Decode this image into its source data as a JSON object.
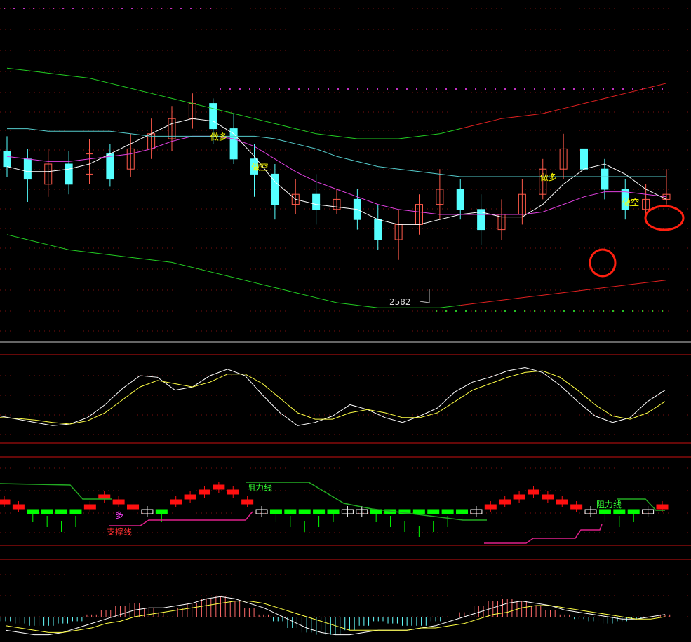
{
  "colors": {
    "background": "#000000",
    "bull_candle": "#ff5a4a",
    "bear_candle": "#55ffff",
    "band_green": "#22cc22",
    "band_red": "#e02020",
    "ma_white": "#ffffff",
    "ma_magenta": "#e040e0",
    "ma_cyan": "#55cccc",
    "stop_red": "#ff2020",
    "kdj_k": "#ffffff",
    "kdj_d": "#ffff44",
    "bar_red": "#ff1010",
    "bar_green": "#00ff00",
    "resist_green": "#22aa22",
    "support_magenta": "#e0208c",
    "label_yellow": "#ffff00",
    "label_red": "#ff3030",
    "label_magenta": "#ff40ff",
    "label_green": "#33ff33",
    "low_label": "#dddddd",
    "divider_red": "#cc1111"
  },
  "chart_data": [
    {
      "type": "candlestick",
      "panel": "price",
      "low_marker": "2582",
      "signals": [
        {
          "index": 10,
          "text": "做多"
        },
        {
          "index": 12,
          "text": "做空"
        },
        {
          "index": 26,
          "text": "做多"
        },
        {
          "index": 30,
          "text": "做空"
        }
      ],
      "candles": [
        {
          "o": 15,
          "c": 9,
          "h": 21,
          "l": 5
        },
        {
          "o": 12,
          "c": 4,
          "h": 16,
          "l": -5
        },
        {
          "o": 2,
          "c": 10,
          "h": 16,
          "l": -3
        },
        {
          "o": 10,
          "c": 2,
          "h": 15,
          "l": -2
        },
        {
          "o": 6,
          "c": 14,
          "h": 20,
          "l": 2
        },
        {
          "o": 14,
          "c": 4,
          "h": 18,
          "l": 1
        },
        {
          "o": 8,
          "c": 16,
          "h": 22,
          "l": 5
        },
        {
          "o": 16,
          "c": 22,
          "h": 28,
          "l": 12
        },
        {
          "o": 20,
          "c": 28,
          "h": 33,
          "l": 15
        },
        {
          "o": 28,
          "c": 34,
          "h": 38,
          "l": 24
        },
        {
          "o": 34,
          "c": 24,
          "h": 36,
          "l": 18
        },
        {
          "o": 24,
          "c": 12,
          "h": 30,
          "l": 10
        },
        {
          "o": 12,
          "c": 6,
          "h": 18,
          "l": -3
        },
        {
          "o": 6,
          "c": -6,
          "h": 10,
          "l": -12
        },
        {
          "o": -6,
          "c": -2,
          "h": 4,
          "l": -10
        },
        {
          "o": -2,
          "c": -8,
          "h": 6,
          "l": -14
        },
        {
          "o": -8,
          "c": -4,
          "h": 0,
          "l": -10
        },
        {
          "o": -4,
          "c": -12,
          "h": 0,
          "l": -16
        },
        {
          "o": -12,
          "c": -20,
          "h": -6,
          "l": -24
        },
        {
          "o": -20,
          "c": -14,
          "h": -8,
          "l": -28
        },
        {
          "o": -14,
          "c": -6,
          "h": -2,
          "l": -18
        },
        {
          "o": -6,
          "c": 0,
          "h": 8,
          "l": -12
        },
        {
          "o": 0,
          "c": -8,
          "h": 4,
          "l": -12
        },
        {
          "o": -8,
          "c": -16,
          "h": -2,
          "l": -22
        },
        {
          "o": -16,
          "c": -10,
          "h": -4,
          "l": -20
        },
        {
          "o": -10,
          "c": -2,
          "h": 4,
          "l": -14
        },
        {
          "o": -2,
          "c": 8,
          "h": 12,
          "l": -4
        },
        {
          "o": 8,
          "c": 16,
          "h": 22,
          "l": 4
        },
        {
          "o": 16,
          "c": 8,
          "h": 22,
          "l": 4
        },
        {
          "o": 8,
          "c": 0,
          "h": 12,
          "l": -4
        },
        {
          "o": 0,
          "c": -8,
          "h": 4,
          "l": -12
        },
        {
          "o": -8,
          "c": -4,
          "h": 2,
          "l": -10
        },
        {
          "o": -4,
          "c": -2,
          "h": 8,
          "l": -6
        }
      ],
      "series": [
        {
          "name": "MA5",
          "values": [
            9,
            7,
            7,
            8,
            10,
            14,
            18,
            22,
            26,
            28,
            27,
            22,
            13,
            3,
            -4,
            -6,
            -7,
            -8,
            -12,
            -14,
            -14,
            -12,
            -10,
            -9,
            -11,
            -11,
            -6,
            2,
            8,
            10,
            6,
            0,
            -4
          ]
        },
        {
          "name": "MA10",
          "values": [
            13,
            12,
            11,
            11,
            12,
            13,
            14,
            16,
            19,
            21,
            21,
            20,
            17,
            12,
            7,
            3,
            0,
            -3,
            -6,
            -8,
            -9,
            -10,
            -10,
            -10,
            -10,
            -10,
            -9,
            -6,
            -3,
            -1,
            -1,
            -2,
            -3
          ]
        },
        {
          "name": "MA20",
          "values": [
            24,
            24,
            23,
            23,
            23,
            23,
            22,
            21,
            21,
            21,
            21,
            21,
            21,
            20,
            18,
            16,
            13,
            11,
            9,
            8,
            7,
            6,
            5,
            5,
            5,
            5,
            5,
            5,
            5,
            5,
            5,
            5,
            5
          ]
        },
        {
          "name": "UPPER",
          "values": [
            48,
            47,
            46,
            45,
            44,
            42,
            40,
            38,
            36,
            34,
            32,
            30,
            28,
            26,
            24,
            22,
            21,
            20,
            20,
            20,
            21,
            22,
            24,
            26,
            28,
            29,
            30,
            32,
            34,
            36,
            38,
            40,
            42
          ]
        },
        {
          "name": "LOWER",
          "values": [
            -18,
            -20,
            -22,
            -24,
            -25,
            -26,
            -27,
            -28,
            -29,
            -31,
            -33,
            -35,
            -37,
            -39,
            -41,
            -43,
            -45,
            -46,
            -47,
            -47,
            -47,
            -47,
            -46,
            -45,
            -44,
            -43,
            -42,
            -41,
            -40,
            -39,
            -38,
            -37,
            -36
          ]
        }
      ]
    },
    {
      "type": "line",
      "panel": "kdj",
      "series": [
        {
          "name": "K",
          "values": [
            30,
            26,
            22,
            18,
            20,
            28,
            44,
            64,
            80,
            78,
            62,
            66,
            80,
            88,
            80,
            56,
            34,
            18,
            22,
            30,
            44,
            38,
            28,
            22,
            30,
            40,
            60,
            72,
            78,
            86,
            90,
            84,
            68,
            48,
            30,
            22,
            28,
            48,
            62
          ]
        },
        {
          "name": "D",
          "values": [
            28,
            27,
            25,
            22,
            20,
            24,
            34,
            50,
            66,
            74,
            70,
            66,
            72,
            82,
            82,
            70,
            52,
            34,
            26,
            26,
            34,
            38,
            34,
            28,
            28,
            34,
            48,
            62,
            70,
            78,
            84,
            86,
            78,
            62,
            44,
            30,
            26,
            34,
            48
          ]
        }
      ]
    },
    {
      "type": "bar",
      "panel": "trend",
      "labels": {
        "multi": "多",
        "support": "支撑线",
        "resist_a": "阻力线",
        "resist_b": "阻力线"
      },
      "values": [
        2,
        1,
        -1,
        -2,
        -3,
        -2,
        1,
        3,
        2,
        1,
        0,
        -1,
        2,
        3,
        4,
        5,
        4,
        2,
        0,
        -1,
        -2,
        -3,
        -2,
        -1,
        0,
        0,
        -1,
        -2,
        -3,
        -4,
        -3,
        -2,
        -1,
        0,
        1,
        2,
        3,
        4,
        3,
        2,
        1,
        0,
        -1,
        -2,
        -1,
        0,
        1
      ]
    },
    {
      "type": "bar",
      "panel": "macd",
      "values": [
        -2,
        -3,
        -4,
        -4,
        -3,
        -2,
        1,
        3,
        5,
        6,
        4,
        2,
        4,
        6,
        8,
        9,
        7,
        4,
        1,
        -2,
        -5,
        -7,
        -8,
        -8,
        -6,
        -4,
        -2,
        -3,
        -4,
        -4,
        -2,
        0,
        2,
        5,
        7,
        8,
        7,
        5,
        3,
        1,
        -1,
        -2,
        -3,
        -2,
        -1,
        0,
        1
      ],
      "series": [
        {
          "name": "DIF",
          "values": [
            -6,
            -7,
            -8,
            -8,
            -7,
            -5,
            -3,
            -1,
            1,
            3,
            4,
            4,
            5,
            6,
            8,
            9,
            8,
            6,
            4,
            1,
            -2,
            -5,
            -7,
            -8,
            -8,
            -7,
            -6,
            -6,
            -6,
            -5,
            -4,
            -2,
            0,
            2,
            4,
            6,
            7,
            6,
            5,
            3,
            2,
            1,
            0,
            -1,
            -1,
            0,
            1
          ]
        },
        {
          "name": "DEA",
          "values": [
            -4,
            -5,
            -6,
            -7,
            -7,
            -6,
            -5,
            -3,
            -2,
            0,
            1,
            2,
            3,
            4,
            5,
            6,
            7,
            7,
            6,
            4,
            2,
            0,
            -2,
            -4,
            -6,
            -6,
            -6,
            -6,
            -6,
            -5,
            -5,
            -4,
            -3,
            -1,
            1,
            2,
            4,
            5,
            5,
            4,
            3,
            2,
            1,
            0,
            -1,
            -1,
            0
          ]
        }
      ]
    }
  ]
}
